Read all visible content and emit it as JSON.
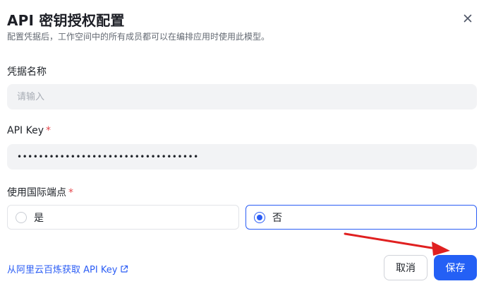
{
  "dialog": {
    "title": "API 密钥授权配置",
    "subtitle": "配置凭据后，工作空间中的所有成员都可以在编排应用时使用此模型。",
    "close_icon": "close-icon"
  },
  "form": {
    "credential_name": {
      "label": "凭据名称",
      "placeholder": "请输入",
      "value": ""
    },
    "api_key": {
      "label": "API Key",
      "required_mark": "*",
      "value": "••••••••••••••••••••••••••••••••••"
    },
    "international_endpoint": {
      "label": "使用国际端点",
      "required_mark": "*",
      "options": [
        {
          "label": "是",
          "selected": false
        },
        {
          "label": "否",
          "selected": true
        }
      ]
    }
  },
  "footer": {
    "link_text": "从阿里云百炼获取 API Key",
    "link_icon": "external-link-icon",
    "cancel_label": "取消",
    "save_label": "保存"
  },
  "annotation": {
    "arrow_color": "#e02020"
  },
  "colors": {
    "primary": "#2460f5",
    "required": "#e5484d"
  }
}
